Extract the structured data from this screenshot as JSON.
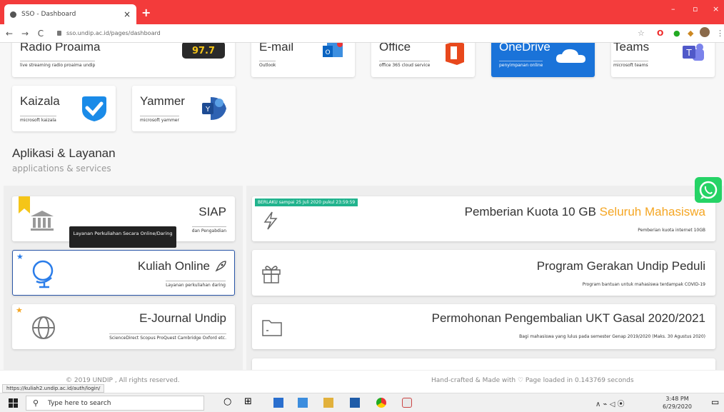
{
  "browser": {
    "tab_title": "SSO - Dashboard",
    "tab_close": "×",
    "new_tab": "+",
    "url": "sso.undip.ac.id/pages/dashboard",
    "nav_back": "←",
    "nav_forward": "→",
    "nav_reload": "C",
    "min": "–",
    "max": "▫",
    "close": "×"
  },
  "apps_top": [
    {
      "title": "Radio Proaima",
      "sub": "live streaming radio proaima undip"
    },
    {
      "title": "E-mail",
      "sub": "Outlook"
    },
    {
      "title": "Office",
      "sub": "office 365 cloud service"
    },
    {
      "title": "OneDrive",
      "sub": "penyimpanan online"
    },
    {
      "title": "Teams",
      "sub": "microsoft teams"
    }
  ],
  "apps_row2": [
    {
      "title": "Kaizala",
      "sub": "microsoft kaizala"
    },
    {
      "title": "Yammer",
      "sub": "microsoft yammer"
    }
  ],
  "section": {
    "title": "Aplikasi & Layanan",
    "subtitle": "applications & services"
  },
  "services": [
    {
      "title": "SIAP",
      "sub": "dan Pengabdian"
    },
    {
      "title": "Kuliah Online",
      "sub": "Layanan perkuliahan daring"
    },
    {
      "title": "E-Journal Undip",
      "sub": "ScienceDirect Scopus ProQuest Cambridge Oxford etc."
    }
  ],
  "tooltip": "Layanan Perkuliahan Secara Online/Daring",
  "news": [
    {
      "badge": "BERLAKU sampai 25 Juli 2020 pukul 23:59:59",
      "title": "Pemberian Kuota 10 GB",
      "highlight": "Seluruh Mahasiswa",
      "sub": "Pemberian kuota internet 10GB"
    },
    {
      "title": "Program Gerakan Undip Peduli",
      "sub": "Program bantuan untuk mahasiswa terdampak COVID-19"
    },
    {
      "title": "Permohonan Pengembalian UKT Gasal 2020/2021",
      "sub": "Bagi mahasiswa yang lulus pada semester Genap 2019/2020 (Maks. 30 Agustus 2020)"
    }
  ],
  "footer": {
    "copyright": "© 2019 UNDIP , All rights reserved.",
    "handcrafted": "Hand-crafted & Made with ♡    Page loaded in 0.143769 seconds"
  },
  "status_url": "https://kuliah2.undip.ac.id/auth/login/",
  "taskbar": {
    "search": "Type here to search",
    "time": "3:48 PM",
    "date": "6/29/2020"
  },
  "colors": {
    "brand_red": "#f33b3b",
    "onedrive_blue": "#1a73d9",
    "highlight_orange": "#f5a623",
    "badge_green": "#21b38d"
  }
}
